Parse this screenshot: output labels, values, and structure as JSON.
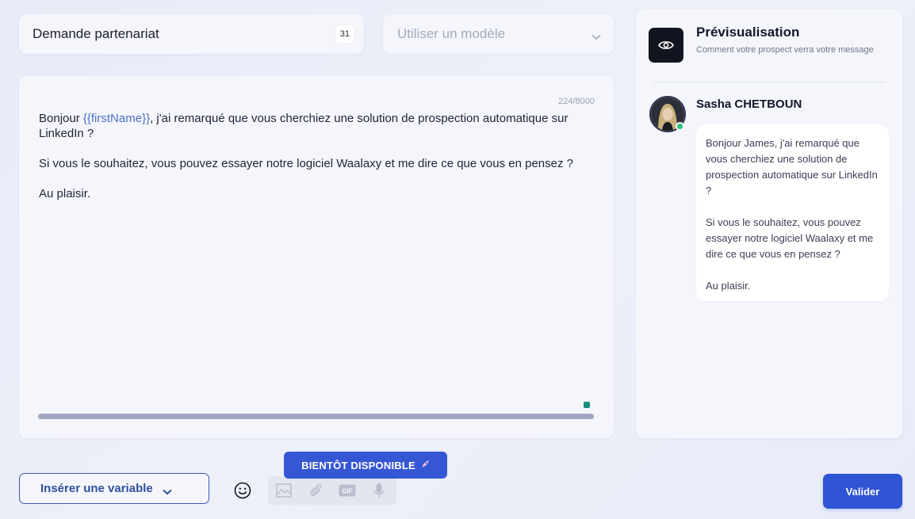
{
  "subject": {
    "value": "Demande partenariat",
    "counter": "31"
  },
  "template": {
    "placeholder": "Utiliser un modèle"
  },
  "editor": {
    "char_count": "224/8000",
    "paragraph1_prefix": "Bonjour ",
    "variable": "{{firstName}}",
    "paragraph1_suffix": ", j'ai remarqué que vous cherchiez une solution de prospection automatique sur LinkedIn ?",
    "paragraph2": "Si vous le souhaitez, vous pouvez essayer notre logiciel Waalaxy et me dire ce que vous en pensez ?",
    "paragraph3": "Au plaisir."
  },
  "preview": {
    "title": "Prévisualisation",
    "subtitle": "Comment votre prospect verra votre message",
    "sender": "Sasha CHETBOUN",
    "bubble_p1": "Bonjour James, j'ai remarqué que vous cherchiez une solution de prospection automatique sur LinkedIn ?",
    "bubble_p2": "Si vous le souhaitez, vous pouvez essayer notre logiciel Waalaxy et me dire ce que vous en pensez ?",
    "bubble_p3": "Au plaisir."
  },
  "toolbar": {
    "insert_variable_label": "Insérer une variable",
    "coming_soon_label": "BIENTÔT DISPONIBLE",
    "validate_label": "Valider",
    "icons": [
      "emoji-icon",
      "image-icon",
      "attachment-icon",
      "gif-icon",
      "microphone-icon"
    ]
  },
  "colors": {
    "accent": "#2f55d4",
    "variable": "#4a6fc4",
    "online": "#2ac27a",
    "dark": "#12141f"
  }
}
